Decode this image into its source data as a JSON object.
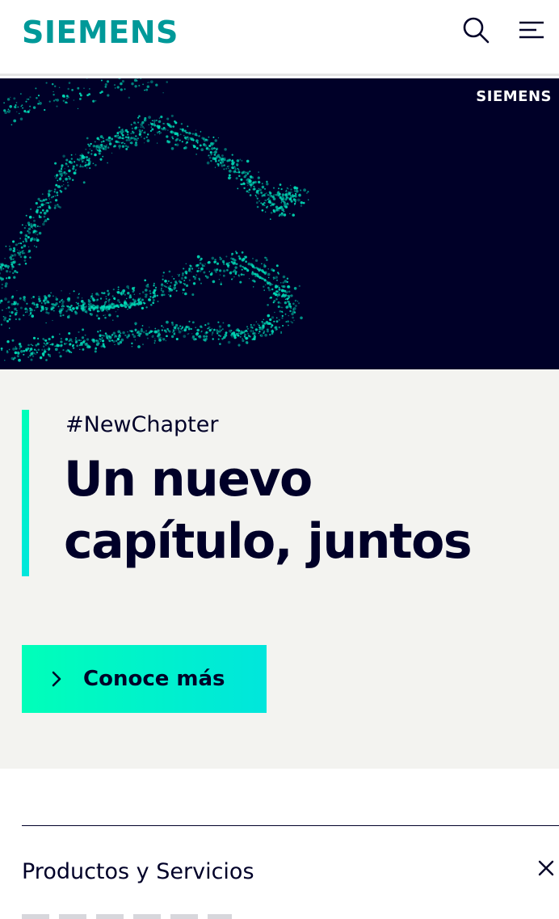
{
  "header": {
    "logo": "SIEMENS",
    "search_icon": "search-icon",
    "menu_icon": "menu-icon"
  },
  "hero": {
    "logo": "SIEMENS",
    "background_color": "#000028",
    "particle_color": "#00d7b4"
  },
  "teaser": {
    "kicker": "#NewChapter",
    "headline": "Un nuevo capítulo, juntos",
    "cta_label": "Conoce más",
    "cta_icon": "chevron-right-icon",
    "accent_colors": [
      "#00ffb9",
      "#00e6dc"
    ]
  },
  "accordion": {
    "title": "Productos y Servicios",
    "close_icon": "close-icon"
  },
  "colors": {
    "brand": "#009999",
    "text": "#000028",
    "teaser_bg": "#f3f3f0"
  }
}
